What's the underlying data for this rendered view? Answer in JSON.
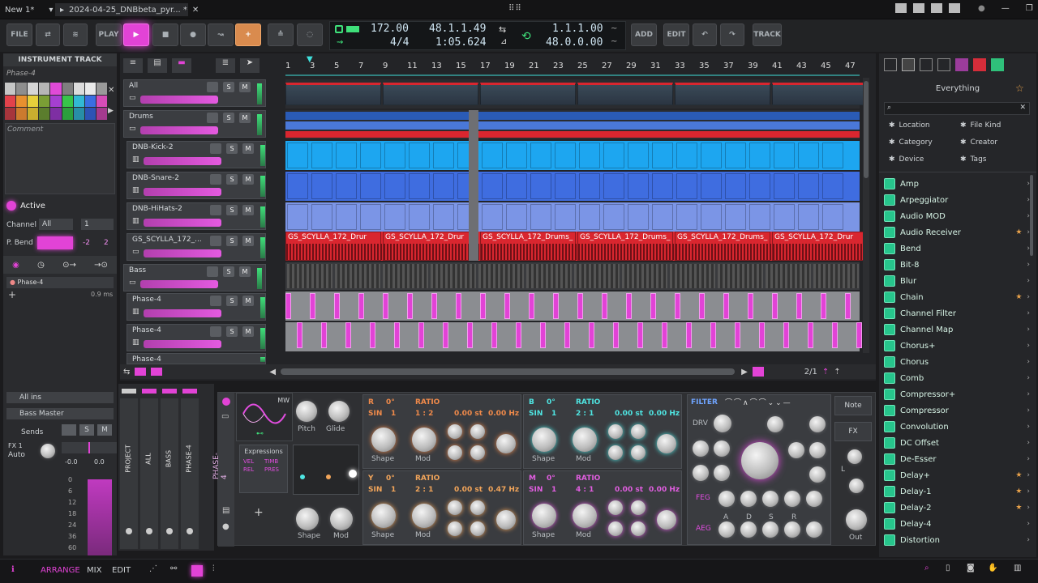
{
  "titlebar": {
    "tab1": "New 1*",
    "tab2": "2024-04-25_DNBbeta_pyr... *"
  },
  "toolbar": {
    "file": "FILE",
    "play": "PLAY",
    "add": "ADD",
    "edit": "EDIT",
    "track": "TRACK",
    "tempo": "172.00",
    "signature": "4/4",
    "position_bars": "48.1.1.49",
    "position_time": "1:05.624",
    "loop_start": "1.1.1.00",
    "loop_length": "48.0.0.00"
  },
  "inspector": {
    "title": "INSTRUMENT TRACK",
    "track_name": "Phase-4",
    "comment": "Comment",
    "active": "Active",
    "channel_label": "Channel",
    "channel_value": "All",
    "channel_num": "1",
    "pbend_label": "P. Bend",
    "pbend_value": "-2",
    "pbend_value2": "2",
    "device_name": "Phase-4",
    "latency": "0.9 ms",
    "input": "All ins",
    "output": "Bass Master",
    "sends": "Sends",
    "fx1": "FX 1",
    "auto": "Auto",
    "meter_val1": "-0.0",
    "meter_val2": "0.0",
    "meter_ticks": [
      "0",
      "6",
      "12",
      "18",
      "24",
      "36",
      "60"
    ]
  },
  "ruler": {
    "bars": [
      "1",
      "3",
      "5",
      "7",
      "9",
      "11",
      "13",
      "15",
      "17",
      "19",
      "21",
      "23",
      "25",
      "27",
      "29",
      "31",
      "33",
      "35",
      "37",
      "39",
      "41",
      "43",
      "45",
      "47"
    ]
  },
  "tracks": [
    {
      "name": "All"
    },
    {
      "name": "Drums"
    },
    {
      "name": "DNB-Kick-2"
    },
    {
      "name": "DNB-Snare-2"
    },
    {
      "name": "DNB-HiHats-2"
    },
    {
      "name": "GS_SCYLLA_172_..."
    },
    {
      "name": "Bass"
    },
    {
      "name": "Phase-4"
    },
    {
      "name": "Phase-4"
    },
    {
      "name": "Phase-4"
    }
  ],
  "clips": {
    "scylla_label": "GS_SCYLLA_172_Drums_",
    "scylla_label_short": "GS_SCYLLA_172_Drur"
  },
  "arranger_footer": {
    "page": "2/1"
  },
  "browser": {
    "title": "Everything",
    "filters": [
      "Location",
      "File Kind",
      "Category",
      "Creator",
      "Device",
      "Tags"
    ],
    "items": [
      {
        "label": "Amp",
        "fav": false
      },
      {
        "label": "Arpeggiator",
        "fav": false
      },
      {
        "label": "Audio MOD",
        "fav": false
      },
      {
        "label": "Audio Receiver",
        "fav": true
      },
      {
        "label": "Bend",
        "fav": false
      },
      {
        "label": "Bit-8",
        "fav": false
      },
      {
        "label": "Blur",
        "fav": false
      },
      {
        "label": "Chain",
        "fav": true
      },
      {
        "label": "Channel Filter",
        "fav": false
      },
      {
        "label": "Channel Map",
        "fav": false
      },
      {
        "label": "Chorus+",
        "fav": false
      },
      {
        "label": "Chorus",
        "fav": false
      },
      {
        "label": "Comb",
        "fav": false
      },
      {
        "label": "Compressor+",
        "fav": false
      },
      {
        "label": "Compressor",
        "fav": false
      },
      {
        "label": "Convolution",
        "fav": false
      },
      {
        "label": "DC Offset",
        "fav": false
      },
      {
        "label": "De-Esser",
        "fav": false
      },
      {
        "label": "Delay+",
        "fav": true
      },
      {
        "label": "Delay-1",
        "fav": true
      },
      {
        "label": "Delay-2",
        "fav": true
      },
      {
        "label": "Delay-4",
        "fav": false
      },
      {
        "label": "Distortion",
        "fav": false
      }
    ]
  },
  "mixer_strips": [
    "PROJECT",
    "ALL",
    "BASS",
    "PHASE-4"
  ],
  "device": {
    "name": "PHASE-4",
    "waveform": "MW",
    "pitch": "Pitch",
    "glide": "Glide",
    "expressions": "Expressions",
    "expr_items": [
      "VEL",
      "TIMB",
      "REL",
      "PRES"
    ],
    "shape": "Shape",
    "mod": "Mod",
    "ops": [
      {
        "letter": "R",
        "phase": "0°",
        "wave": "SIN",
        "num": "1",
        "ratio_label": "RATIO",
        "ratio": "1 : 2",
        "st": "0.00 st",
        "hz": "0.00 Hz",
        "color": "#f08a4a"
      },
      {
        "letter": "B",
        "phase": "0°",
        "wave": "SIN",
        "num": "1",
        "ratio_label": "RATIO",
        "ratio": "2 : 1",
        "st": "0.00 st",
        "hz": "0.00 Hz",
        "color": "#4fe6e3"
      },
      {
        "letter": "Y",
        "phase": "0°",
        "wave": "SIN",
        "num": "1",
        "ratio_label": "RATIO",
        "ratio": "2 : 1",
        "st": "0.00 st",
        "hz": "0.47 Hz",
        "color": "#f2a55a"
      },
      {
        "letter": "M",
        "phase": "0°",
        "wave": "SIN",
        "num": "1",
        "ratio_label": "RATIO",
        "ratio": "4 : 1",
        "st": "0.00 st",
        "hz": "0.00 Hz",
        "color": "#e15ee0"
      }
    ],
    "filter": "FILTER",
    "drv": "DRV",
    "env_labels": [
      "A",
      "D",
      "S",
      "R"
    ],
    "feg": "FEG",
    "aeg": "AEG",
    "out": "Out",
    "note": "Note",
    "fx": "FX",
    "l": "L"
  },
  "bottombar": {
    "arrange": "ARRANGE",
    "mix": "MIX",
    "edit": "EDIT"
  },
  "colors": {
    "accent": "#e243d6",
    "kick": "#1da6f0",
    "snare": "#3f6de0",
    "hats": "#7b95e6",
    "scylla": "#d9262f",
    "browser_icon": "#27c58c"
  }
}
